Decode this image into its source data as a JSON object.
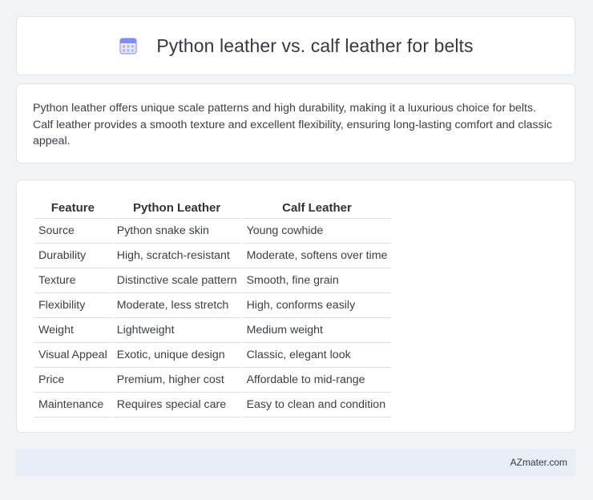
{
  "header": {
    "icon": "calendar-icon",
    "title": "Python leather vs. calf leather for belts"
  },
  "summary": {
    "text": "Python leather offers unique scale patterns and high durability, making it a luxurious choice for belts. Calf leather provides a smooth texture and excellent flexibility, ensuring long-lasting comfort and classic appeal."
  },
  "table": {
    "headers": [
      "Feature",
      "Python Leather",
      "Calf Leather"
    ],
    "rows": [
      [
        "Source",
        "Python snake skin",
        "Young cowhide"
      ],
      [
        "Durability",
        "High, scratch-resistant",
        "Moderate, softens over time"
      ],
      [
        "Texture",
        "Distinctive scale pattern",
        "Smooth, fine grain"
      ],
      [
        "Flexibility",
        "Moderate, less stretch",
        "High, conforms easily"
      ],
      [
        "Weight",
        "Lightweight",
        "Medium weight"
      ],
      [
        "Visual Appeal",
        "Exotic, unique design",
        "Classic, elegant look"
      ],
      [
        "Price",
        "Premium, higher cost",
        "Affordable to mid-range"
      ],
      [
        "Maintenance",
        "Requires special care",
        "Easy to clean and condition"
      ]
    ]
  },
  "footer": {
    "site": "AZmater.com"
  },
  "colors": {
    "background": "#f1f3f7",
    "card": "#ffffff",
    "footer": "#e8edf6",
    "icon_accent": "#7c8cf0"
  }
}
